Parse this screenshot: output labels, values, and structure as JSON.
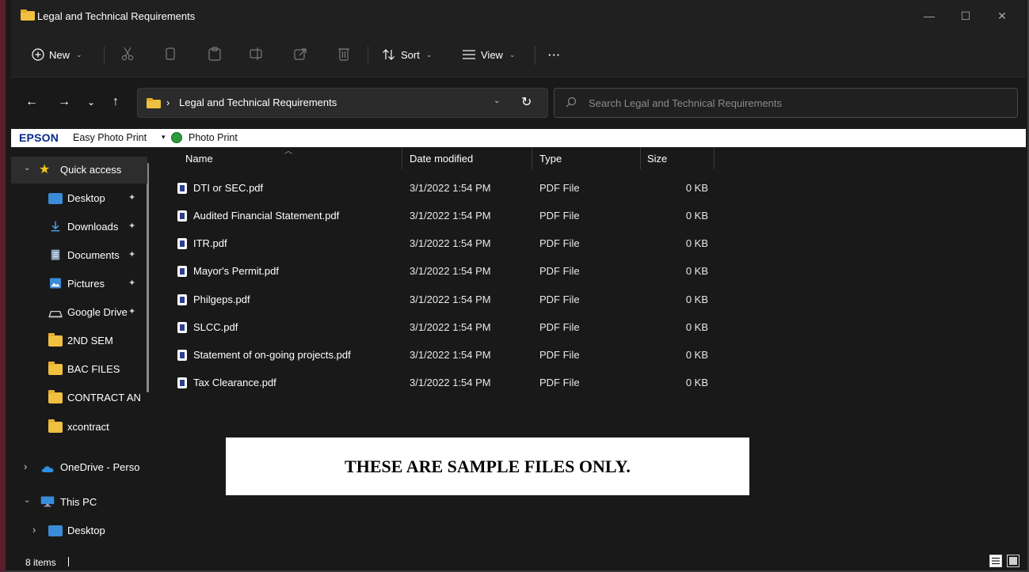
{
  "window": {
    "title": "Legal and Technical Requirements",
    "minimize": "—",
    "maximize": "☐",
    "close": "✕"
  },
  "toolbar": {
    "new_label": "New",
    "sort_label": "Sort",
    "view_label": "View",
    "more_label": "···",
    "chevron": "⌄"
  },
  "address": {
    "breadcrumb": "Legal and Technical Requirements",
    "crumb_sep": "›",
    "dropdown": "⌄",
    "refresh": "↻",
    "back": "←",
    "forward": "→",
    "recent": "⌄",
    "up": "↑"
  },
  "search": {
    "placeholder": "Search Legal and Technical Requirements"
  },
  "epson": {
    "brand": "EPSON",
    "easy_photo_print": "Easy Photo Print",
    "dropdown": "▾",
    "photo_print": "Photo Print"
  },
  "sidebar": {
    "items": [
      {
        "label": "Quick access",
        "expander": "⌄"
      },
      {
        "label": "Desktop"
      },
      {
        "label": "Downloads"
      },
      {
        "label": "Documents"
      },
      {
        "label": "Pictures"
      },
      {
        "label": "Google Drive"
      },
      {
        "label": "2ND SEM"
      },
      {
        "label": "BAC FILES"
      },
      {
        "label": "CONTRACT AN"
      },
      {
        "label": "xcontract"
      },
      {
        "label": "OneDrive - Perso",
        "expander": "›"
      },
      {
        "label": "This PC",
        "expander": "⌄"
      },
      {
        "label": "Desktop",
        "expander": "›"
      }
    ],
    "pin": "📌"
  },
  "columns": {
    "name": "Name",
    "date": "Date modified",
    "type": "Type",
    "size": "Size"
  },
  "files": [
    {
      "name": "DTI or SEC.pdf",
      "date": "3/1/2022 1:54 PM",
      "type": "PDF File",
      "size": "0 KB"
    },
    {
      "name": "Audited Financial Statement.pdf",
      "date": "3/1/2022 1:54 PM",
      "type": "PDF File",
      "size": "0 KB"
    },
    {
      "name": "ITR.pdf",
      "date": "3/1/2022 1:54 PM",
      "type": "PDF File",
      "size": "0 KB"
    },
    {
      "name": "Mayor's Permit.pdf",
      "date": "3/1/2022 1:54 PM",
      "type": "PDF File",
      "size": "0 KB"
    },
    {
      "name": "Philgeps.pdf",
      "date": "3/1/2022 1:54 PM",
      "type": "PDF File",
      "size": "0 KB"
    },
    {
      "name": "SLCC.pdf",
      "date": "3/1/2022 1:54 PM",
      "type": "PDF File",
      "size": "0 KB"
    },
    {
      "name": "Statement of on-going projects.pdf",
      "date": "3/1/2022 1:54 PM",
      "type": "PDF File",
      "size": "0 KB"
    },
    {
      "name": "Tax Clearance.pdf",
      "date": "3/1/2022 1:54 PM",
      "type": "PDF File",
      "size": "0 KB"
    }
  ],
  "notice": "THESE ARE SAMPLE FILES ONLY.",
  "status": {
    "item_count": "8 items"
  },
  "colors": {
    "window_bg": "#191919",
    "chrome_bg": "#202020",
    "accent_border": "#5a1e2c",
    "folder_yellow": "#f0c040",
    "pdf_icon_blue": "#2c3e8c",
    "epson_blue": "#0a2a8a"
  }
}
